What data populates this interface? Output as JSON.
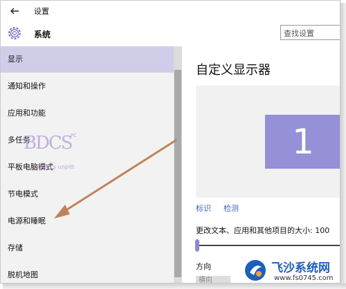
{
  "window": {
    "title": "设置"
  },
  "header": {
    "section_title": "系统",
    "search_placeholder": "查找设置"
  },
  "sidebar": {
    "items": [
      {
        "label": "显示",
        "active": true
      },
      {
        "label": "通知和操作"
      },
      {
        "label": "应用和功能"
      },
      {
        "label": "多任务"
      },
      {
        "label": "平板电脑模式"
      },
      {
        "label": "节电模式"
      },
      {
        "label": "电源和睡眠"
      },
      {
        "label": "存储"
      },
      {
        "label": "脱机地图"
      }
    ]
  },
  "main": {
    "title": "自定义显示器",
    "monitor_number": "1",
    "links": {
      "identify": "标识",
      "detect": "检测"
    },
    "size_label": "更改文本、应用和其他项目的大小: 100",
    "orientation_label": "方向",
    "orientation_value": "横向"
  },
  "watermarks": {
    "bdcs": {
      "text": "BDCS",
      "pc": "PC",
      "sub": "百度·cs unpitt"
    },
    "site": {
      "name": "飞沙系统网",
      "url": "www.fs0745.com"
    }
  },
  "colors": {
    "accent": "#9590d7",
    "active_nav": "#cfcde8",
    "link": "#3d67b6",
    "arrow": "#c0825a"
  }
}
